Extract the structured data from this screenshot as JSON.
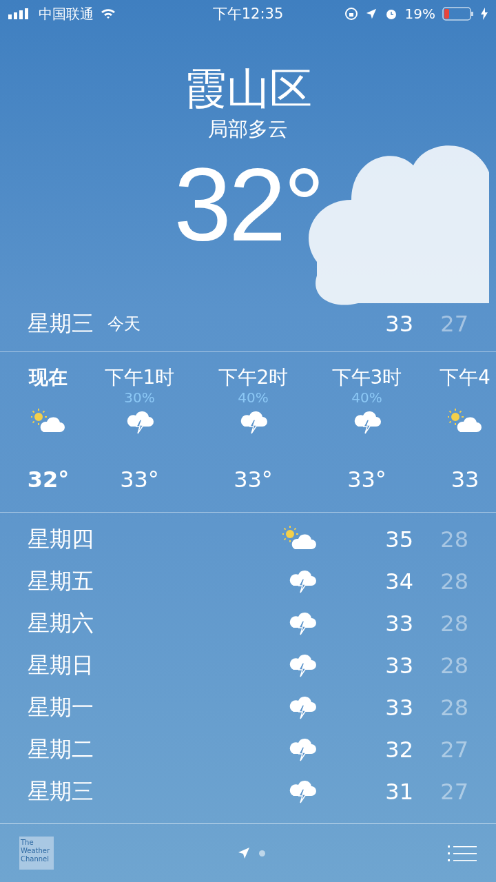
{
  "status_bar": {
    "carrier": "中国联通",
    "time": "下午12:35",
    "battery": "19%"
  },
  "header": {
    "city": "霞山区",
    "condition": "局部多云",
    "temperature": "32°"
  },
  "today": {
    "day": "星期三",
    "label": "今天",
    "high": "33",
    "low": "27"
  },
  "hourly": [
    {
      "time": "现在",
      "kind": "partly_cloudy",
      "temp": "32°",
      "now": true
    },
    {
      "time": "下午1时",
      "precip": "30%",
      "kind": "thunder",
      "temp": "33°",
      "now": false
    },
    {
      "time": "下午2时",
      "precip": "40%",
      "kind": "thunder",
      "temp": "33°",
      "now": false
    },
    {
      "time": "下午3时",
      "precip": "40%",
      "kind": "thunder",
      "temp": "33°",
      "now": false
    },
    {
      "time": "下午4",
      "kind": "partly_cloudy",
      "temp": "33",
      "now": false
    }
  ],
  "daily": [
    {
      "day": "星期四",
      "kind": "partly_cloudy",
      "high": "35",
      "low": "28"
    },
    {
      "day": "星期五",
      "kind": "thunder",
      "high": "34",
      "low": "28"
    },
    {
      "day": "星期六",
      "kind": "thunder",
      "high": "33",
      "low": "28"
    },
    {
      "day": "星期日",
      "kind": "thunder",
      "high": "33",
      "low": "28"
    },
    {
      "day": "星期一",
      "kind": "thunder",
      "high": "33",
      "low": "28"
    },
    {
      "day": "星期二",
      "kind": "thunder",
      "high": "32",
      "low": "27"
    },
    {
      "day": "星期三",
      "kind": "thunder",
      "high": "31",
      "low": "27"
    }
  ],
  "bottom_bar": {
    "logo": [
      "The",
      "Weather",
      "Channel"
    ],
    "pages": [
      {
        "kind": "location",
        "selected": true
      },
      {
        "kind": "dot",
        "selected": false
      }
    ]
  }
}
